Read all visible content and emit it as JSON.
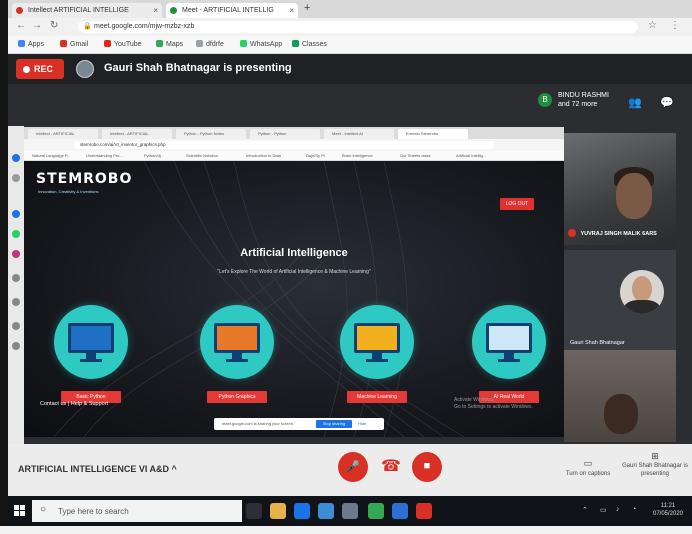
{
  "browser": {
    "tabs": [
      {
        "label": "Intellect ARTIFICIAL INTELLIGE",
        "color": "#d93025"
      },
      {
        "label": "Meet - ARTIFICIAL INTELLIG",
        "color": "#1e8e3e"
      }
    ],
    "url": "meet.google.com/mjw-mzbz-xzb",
    "bookmarks": [
      {
        "label": "Apps",
        "color": "#4285f4"
      },
      {
        "label": "Gmail",
        "color": "#d93025"
      },
      {
        "label": "YouTube",
        "color": "#e62117"
      },
      {
        "label": "Maps",
        "color": "#34a853"
      },
      {
        "label": "dfdrfe",
        "color": "#9aa0a6"
      },
      {
        "label": "WhatsApp",
        "color": "#25d366"
      },
      {
        "label": "Classes",
        "color": "#0f9d58"
      }
    ]
  },
  "meet": {
    "rec_label": "REC",
    "presenting_text": "Gauri Shah Bhatnagar is presenting",
    "participants": {
      "avatar_letter": "B",
      "line1": "BINDU RASHMI",
      "line2": "and 72 more"
    },
    "people_icon": "people-icon",
    "chat_icon": "chat-icon",
    "meeting_name": "ARTIFICIAL INTELLIGENCE VI A&D",
    "captions_label": "Turn on captions",
    "presenting_label": "Gauri Shah Bhatnagar is presenting",
    "tiles": [
      {
        "name": "YUVRAJ SINGH MALIK 6ARS"
      },
      {
        "name": "Gauri Shah Bhatnagar"
      }
    ],
    "share_bar": {
      "text": "meet.google.com is sharing your screen.",
      "stop": "Stop sharing",
      "hide": "Hide"
    }
  },
  "shared_site": {
    "tabs": [
      "Intellect - ARTIFICIAL",
      "Intellect - ARTIFICIAL",
      "Python - Python Notes",
      "Python - Python",
      "Meet - Intellect AI",
      "Ernesto Stemrobo"
    ],
    "url": "stemrobo.com/ai/VI_inventor_graphics.php",
    "bookmarks": [
      "Natural Language P...",
      "Understanding Pro...",
      "Python/dj",
      "Scientific Notation",
      "Introduction to Data",
      "Dojo/Sy Pl",
      "Brain Intelligence",
      "Our Sheets class",
      "Artificial Intellig..."
    ],
    "logo": "STEMROBO",
    "logo_sub": "Innovation, Creativity & Inventions",
    "logout": "LOG OUT",
    "title": "Artificial Intelligence",
    "subtitle": "\"Let's Explore The World of Artificial Intelligence & Machine Learning\"",
    "cards": [
      {
        "label": "Basic Python"
      },
      {
        "label": "Python Graphics"
      },
      {
        "label": "Machine Learning"
      },
      {
        "label": "AI Real World"
      }
    ],
    "contact": "Contact us | Help & Support",
    "activate_line1": "Activate Windows",
    "activate_line2": "Go to Settings to activate Windows."
  },
  "taskbar": {
    "search_placeholder": "Type here to search",
    "time": "11:21",
    "date": "07/05/2020"
  }
}
